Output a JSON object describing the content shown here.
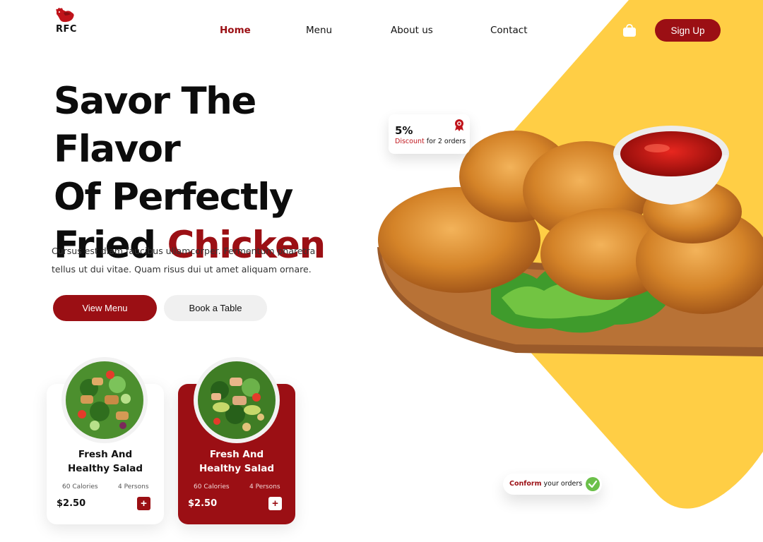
{
  "brand": {
    "name": "RFC"
  },
  "nav": {
    "items": [
      {
        "label": "Home",
        "active": true
      },
      {
        "label": "Menu",
        "active": false
      },
      {
        "label": "About us",
        "active": false
      },
      {
        "label": "Contact",
        "active": false
      }
    ],
    "cart_icon": "shopping-bag-icon",
    "signup_label": "Sign Up"
  },
  "hero": {
    "title_line1": "Savor The Flavor",
    "title_line2": "Of Perfectly",
    "title_line3_plain": "Fried",
    "title_line3_accent": "Chicken",
    "description": "Cursus est diam faucibus ullamcorper. Fermentum pharetra tellus ut dui vitae. Quam risus dui ut amet aliquam ornare.",
    "primary_button": "View Menu",
    "secondary_button": "Book a Table"
  },
  "discount": {
    "percent": "5%",
    "label_accent": "Discount",
    "label_rest": "for 2 orders",
    "icon": "award-badge-icon"
  },
  "confirm": {
    "accent": "Conform",
    "rest": "your orders",
    "icon": "check-circle-icon"
  },
  "products": [
    {
      "title_line1": "Fresh And",
      "title_line2": "Healthy Salad",
      "calories": "60 Calories",
      "persons": "4 Persons",
      "price": "$2.50",
      "add_label": "+"
    },
    {
      "title_line1": "Fresh And",
      "title_line2": "Healthy Salad",
      "calories": "60 Calories",
      "persons": "4 Persons",
      "price": "$2.50",
      "add_label": "+"
    }
  ],
  "colors": {
    "brand_red": "#9b0f14",
    "accent_yellow": "#ffce45",
    "check_green": "#6cc04a"
  }
}
